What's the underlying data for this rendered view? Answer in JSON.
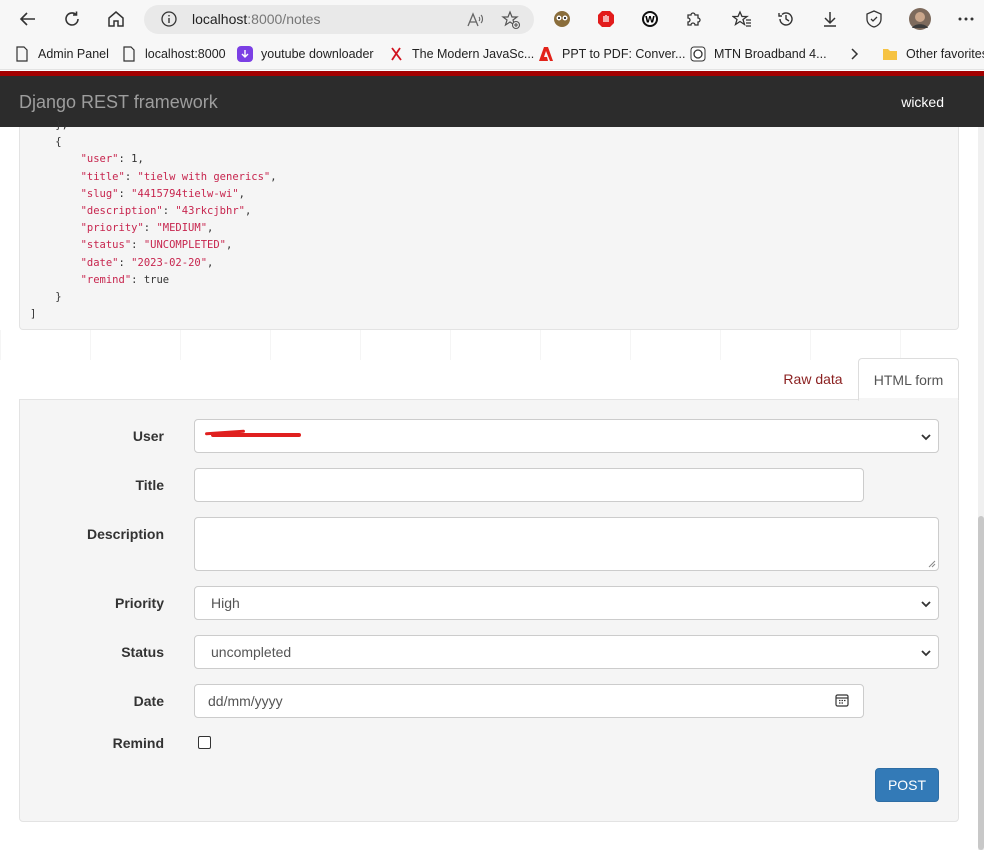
{
  "browser": {
    "url_host": "localhost",
    "url_path": ":8000/notes"
  },
  "bookmarks": [
    {
      "label": "Admin Panel"
    },
    {
      "label": "localhost:8000"
    },
    {
      "label": "youtube downloader"
    },
    {
      "label": "The Modern JavaSc..."
    },
    {
      "label": "PPT to PDF: Conver..."
    },
    {
      "label": "MTN Broadband 4..."
    },
    {
      "label": "Other favorites"
    }
  ],
  "navbar": {
    "brand": "Django REST framework",
    "user": "wicked"
  },
  "response": {
    "lines": [
      {
        "indent": "    ",
        "text": "},"
      },
      {
        "indent": "    ",
        "text": "{"
      },
      {
        "key": "\"user\"",
        "sep": ": ",
        "val": "1",
        "val_type": "p",
        "tail": ","
      },
      {
        "key": "\"title\"",
        "sep": ": ",
        "val": "\"tielw with generics\"",
        "val_type": "s",
        "tail": ","
      },
      {
        "key": "\"slug\"",
        "sep": ": ",
        "val": "\"4415794tielw-wi\"",
        "val_type": "s",
        "tail": ","
      },
      {
        "key": "\"description\"",
        "sep": ": ",
        "val": "\"43rkcjbhr\"",
        "val_type": "s",
        "tail": ","
      },
      {
        "key": "\"priority\"",
        "sep": ": ",
        "val": "\"MEDIUM\"",
        "val_type": "s",
        "tail": ","
      },
      {
        "key": "\"status\"",
        "sep": ": ",
        "val": "\"UNCOMPLETED\"",
        "val_type": "s",
        "tail": ","
      },
      {
        "key": "\"date\"",
        "sep": ": ",
        "val": "\"2023-02-20\"",
        "val_type": "s",
        "tail": ","
      },
      {
        "key": "\"remind\"",
        "sep": ": ",
        "val": "true",
        "val_type": "p",
        "tail": ""
      },
      {
        "indent": "    ",
        "text": "}"
      },
      {
        "indent": "",
        "text": "]"
      }
    ]
  },
  "tabs": {
    "raw": "Raw data",
    "html": "HTML form"
  },
  "form": {
    "user_label": "User",
    "title_label": "Title",
    "description_label": "Description",
    "priority_label": "Priority",
    "priority_value": "High",
    "status_label": "Status",
    "status_value": "uncompleted",
    "date_label": "Date",
    "date_placeholder": "dd/mm/yyyy",
    "remind_label": "Remind",
    "remind_checked": false,
    "submit_label": "POST"
  },
  "colors": {
    "accent_red": "#a30000",
    "navbar_bg": "#2c2c2c",
    "primary_button": "#337ab7",
    "json_string": "#c7254e"
  }
}
